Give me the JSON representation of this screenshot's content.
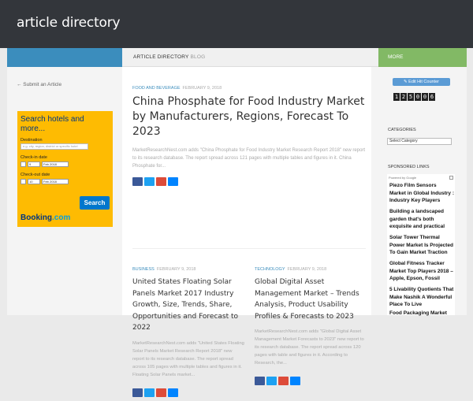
{
  "header": {
    "site_title": "article directory"
  },
  "navbar": {
    "breadcrumb_main": "ARTICLE DIRECTORY",
    "breadcrumb_sub": "BLOG",
    "more_label": "MORE"
  },
  "left_sidebar": {
    "submit_link": "← Submit an Article",
    "booking": {
      "title": "Search hotels and more...",
      "destination_label": "Destination",
      "destination_placeholder": "e.g. city, region, district or specific hotel",
      "checkin_label": "Check-in date",
      "checkout_label": "Check-out date",
      "checkin_day": "9",
      "checkin_month": "Feb 2018",
      "checkout_day": "10",
      "checkout_month": "Feb 2018",
      "search_button": "Search",
      "logo_main": "Booking",
      "logo_dot": ".com"
    }
  },
  "main": {
    "featured": {
      "category": "FOOD AND BEVERAGE",
      "date": "FEBRUARY 9, 2018",
      "title": "China Phosphate for Food Industry Market by Manufacturers, Regions, Forecast To 2023",
      "excerpt": "MarketResearchNest.com adds \"China Phosphate for Food Industry Market Research Report 2018\" new report to its research database. The report spread across 121 pages with multiple tables and figures in it.   China Phosphate for..."
    },
    "posts": [
      {
        "category": "BUSINESS",
        "date": "FEBRUARY 9, 2018",
        "title": "United States Floating Solar Panels Market 2017 Industry Growth, Size, Trends, Share, Opportunities and Forecast to 2022",
        "excerpt": "MarketResearchNest.com adds \"United States Floating Solar Panels Market Research Report 2018\" new report to its research database. The report spread across 105 pages with multiple tables and figures in it.   Floating Solar Panels market..."
      },
      {
        "category": "TECHNOLOGY",
        "date": "FEBRUARY 9, 2018",
        "title": "Global Digital Asset Management Market – Trends Analysis, Product Usability Profiles & Forecasts to 2023",
        "excerpt": "MarketResearchNest.com adds \"Global Digital Asset Management Market Forecasts to 2023\" new report to its research database. The report spread across 120 pages with table and figures in it.   According to Research, the..."
      }
    ]
  },
  "right_sidebar": {
    "hit_counter_button": "Edit Hit Counter",
    "counter_digits": [
      "1",
      "2",
      "5",
      "0",
      "0",
      "6"
    ],
    "categories_title": "CATEGORIES",
    "categories_select": "Select Category",
    "sponsored_title": "SPONSORED LINKS",
    "ads_by": "Powered by Google",
    "ads": [
      "Piezo Film Sensors Market in Global Industry : Industry Key Players",
      "Building a landscaped garden that's both exquisite and practical",
      "Solar Tower Thermal Power Market Is Projected To Gain Market Traction",
      "Global Fitness Tracker Market Top Players 2018 – Apple, Epson, Fossil",
      "5 Livability Quotients That Make Nashik A Wonderful Place To Live",
      "Food Packaging Market"
    ]
  }
}
